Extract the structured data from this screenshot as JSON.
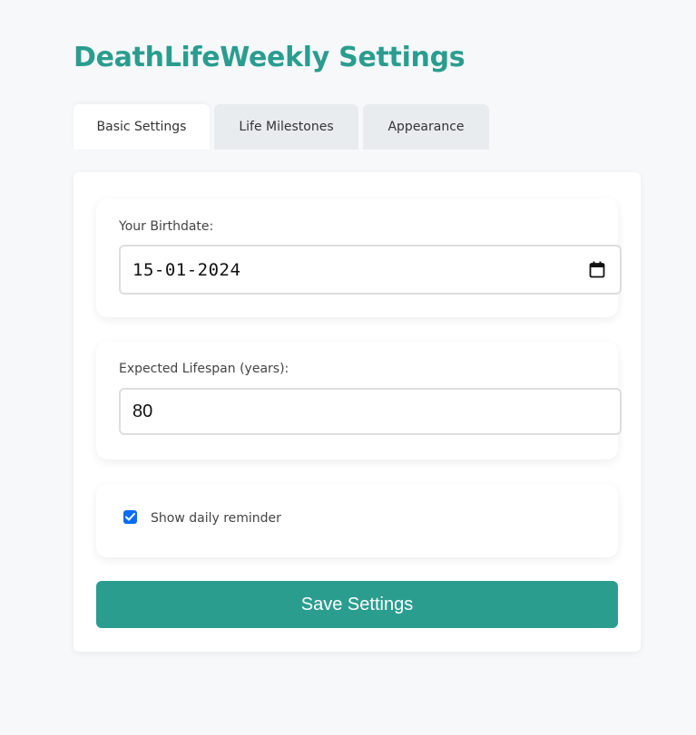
{
  "header": {
    "title": "DeathLifeWeekly Settings"
  },
  "tabs": [
    {
      "label": "Basic Settings",
      "active": true
    },
    {
      "label": "Life Milestones",
      "active": false
    },
    {
      "label": "Appearance",
      "active": false
    }
  ],
  "birthdate": {
    "label": "Your Birthdate:",
    "value": "15-01-2024"
  },
  "lifespan": {
    "label": "Expected Lifespan (years):",
    "value": "80"
  },
  "reminder": {
    "label": "Show daily reminder",
    "checked": true
  },
  "save": {
    "label": "Save Settings"
  },
  "icons": {
    "calendar": "calendar-icon",
    "checkmark": "checkmark-icon"
  },
  "colors": {
    "accent": "#2a9d8f",
    "checkbox": "#0b6cf5",
    "background": "#f6f8fa"
  }
}
